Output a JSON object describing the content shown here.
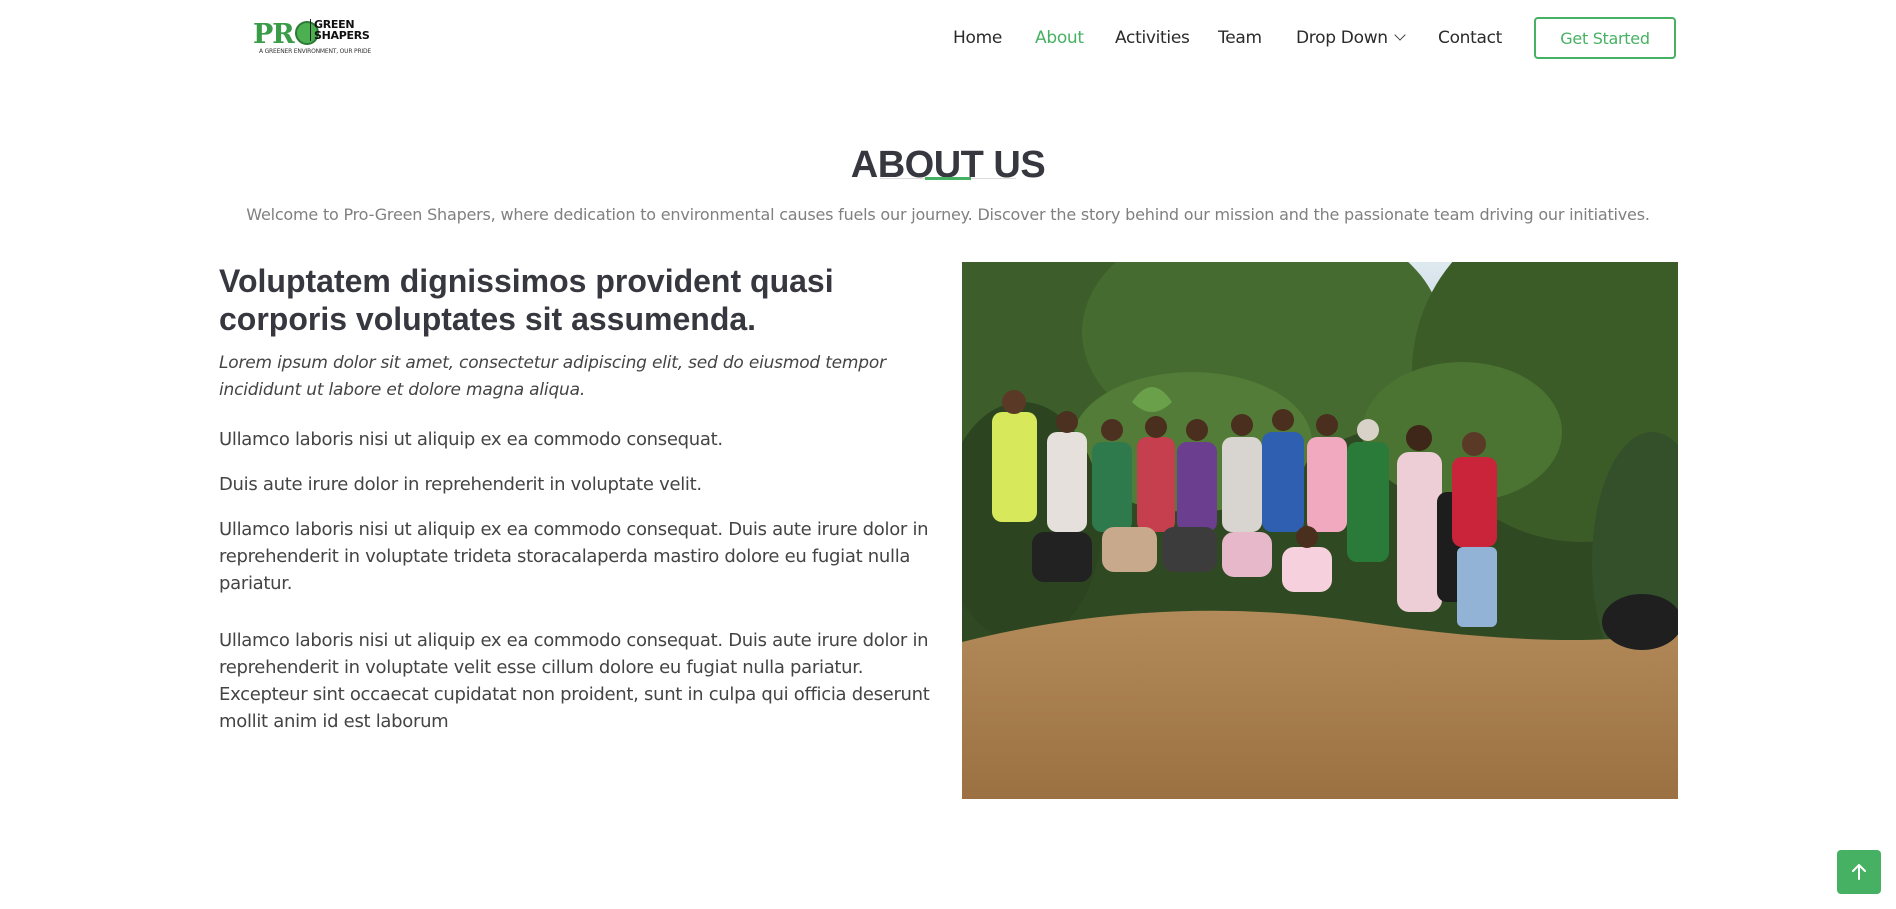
{
  "brand": {
    "logo_pro": "PRO",
    "logo_green": "GREEN",
    "logo_shapers": "SHAPERS",
    "tagline": "A GREENER ENVIRONMENT, OUR PRIDE"
  },
  "nav": {
    "items": [
      {
        "label": "Home",
        "active": false
      },
      {
        "label": "About",
        "active": true
      },
      {
        "label": "Activities",
        "active": false
      },
      {
        "label": "Team",
        "active": false
      },
      {
        "label": "Drop Down",
        "active": false
      },
      {
        "label": "Contact",
        "active": false
      }
    ],
    "cta": "Get Started"
  },
  "section": {
    "title": "ABOUT US",
    "subtitle": "Welcome to Pro-Green Shapers, where dedication to environmental causes fuels our journey. Discover the story behind our mission and the passionate team driving our initiatives."
  },
  "content": {
    "heading": "Voluptatem dignissimos provident quasi corporis voluptates sit assumenda.",
    "italic": "Lorem ipsum dolor sit amet, consectetur adipiscing elit, sed do eiusmod tempor incididunt ut labore et dolore magna aliqua.",
    "p1": " Ullamco laboris nisi ut aliquip ex ea commodo consequat.",
    "p2": " Duis aute irure dolor in reprehenderit in voluptate velit.",
    "p3": " Ullamco laboris nisi ut aliquip ex ea commodo consequat. Duis aute irure dolor in reprehenderit in voluptate trideta storacalaperda mastiro dolore eu fugiat nulla pariatur.",
    "p4": "Ullamco laboris nisi ut aliquip ex ea commodo consequat. Duis aute irure dolor in reprehenderit in voluptate velit esse cillum dolore eu fugiat nulla pariatur. Excepteur sint occaecat cupidatat non proident, sunt in culpa qui officia deserunt mollit anim id est laborum"
  },
  "colors": {
    "accent": "#47b163",
    "heading": "#37373f",
    "text": "#444444",
    "muted": "#808080"
  },
  "icons": {
    "dropdown": "chevron-down-icon",
    "back_to_top": "arrow-up-icon"
  }
}
